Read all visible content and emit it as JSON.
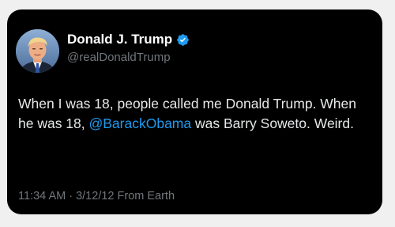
{
  "tweet": {
    "author": {
      "display_name": "Donald J. Trump",
      "handle": "@realDonaldTrump",
      "verified_icon": "verified-badge-icon",
      "avatar": "profile-photo"
    },
    "text": {
      "part1": "When I was 18, people called me Donald Trump. When he was 18, ",
      "mention": "@BarackObama",
      "part2": " was Barry Soweto. Weird."
    },
    "meta": {
      "time": "11:34 AM",
      "separator": " · ",
      "date": "3/12/12",
      "source": " From Earth"
    }
  },
  "colors": {
    "card_background": "#000000",
    "page_background": "#f0f0f0",
    "primary_text": "#e7e9ea",
    "secondary_text": "#71767b",
    "accent": "#1d9bf0"
  }
}
